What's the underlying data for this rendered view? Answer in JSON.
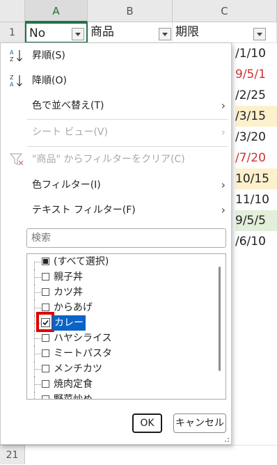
{
  "sheet": {
    "columns": [
      "A",
      "B",
      "C"
    ],
    "row_numbers": [
      "1",
      "21"
    ],
    "header_cells": [
      "No",
      "商品",
      "期限"
    ],
    "date_values": [
      {
        "text": "/1/10",
        "color": "#222222",
        "bg": "#ffffff"
      },
      {
        "text": "9/5/1",
        "color": "#d0312d",
        "bg": "#ffffff"
      },
      {
        "text": "/2/25",
        "color": "#222222",
        "bg": "#ffffff"
      },
      {
        "text": "/3/15",
        "color": "#222222",
        "bg": "#fdf0cc"
      },
      {
        "text": "/3/20",
        "color": "#222222",
        "bg": "#ffffff"
      },
      {
        "text": "/7/20",
        "color": "#d0312d",
        "bg": "#ffffff"
      },
      {
        "text": "10/15",
        "color": "#222222",
        "bg": "#fdf0cc"
      },
      {
        "text": "11/10",
        "color": "#222222",
        "bg": "#ffffff"
      },
      {
        "text": "9/5/5",
        "color": "#222222",
        "bg": "#e2efda"
      },
      {
        "text": "/6/10",
        "color": "#222222",
        "bg": "#ffffff"
      }
    ]
  },
  "menu": {
    "sort_asc": "昇順(S)",
    "sort_desc": "降順(O)",
    "sort_by_color": "色で並べ替え(T)",
    "sheet_view": "シート ビュー(V)",
    "clear_filter": "\"商品\" からフィルターをクリア(C)",
    "color_filter": "色フィルター(I)",
    "text_filter": "テキスト フィルター(F)",
    "chevron": "›",
    "search_placeholder": "検索",
    "list_items": [
      "(すべて選択)",
      "親子丼",
      "カツ丼",
      "からあげ",
      "カレー",
      "ハヤシライス",
      "ミートパスタ",
      "メンチカツ",
      "焼肉定食",
      "野菜炒め"
    ],
    "checked_index": 4,
    "ok_label": "OK",
    "cancel_label": "キャンセル"
  },
  "colors": {
    "selection_blue": "#0a64c8",
    "highlight_red": "#e00000",
    "accent_green": "#217346"
  }
}
